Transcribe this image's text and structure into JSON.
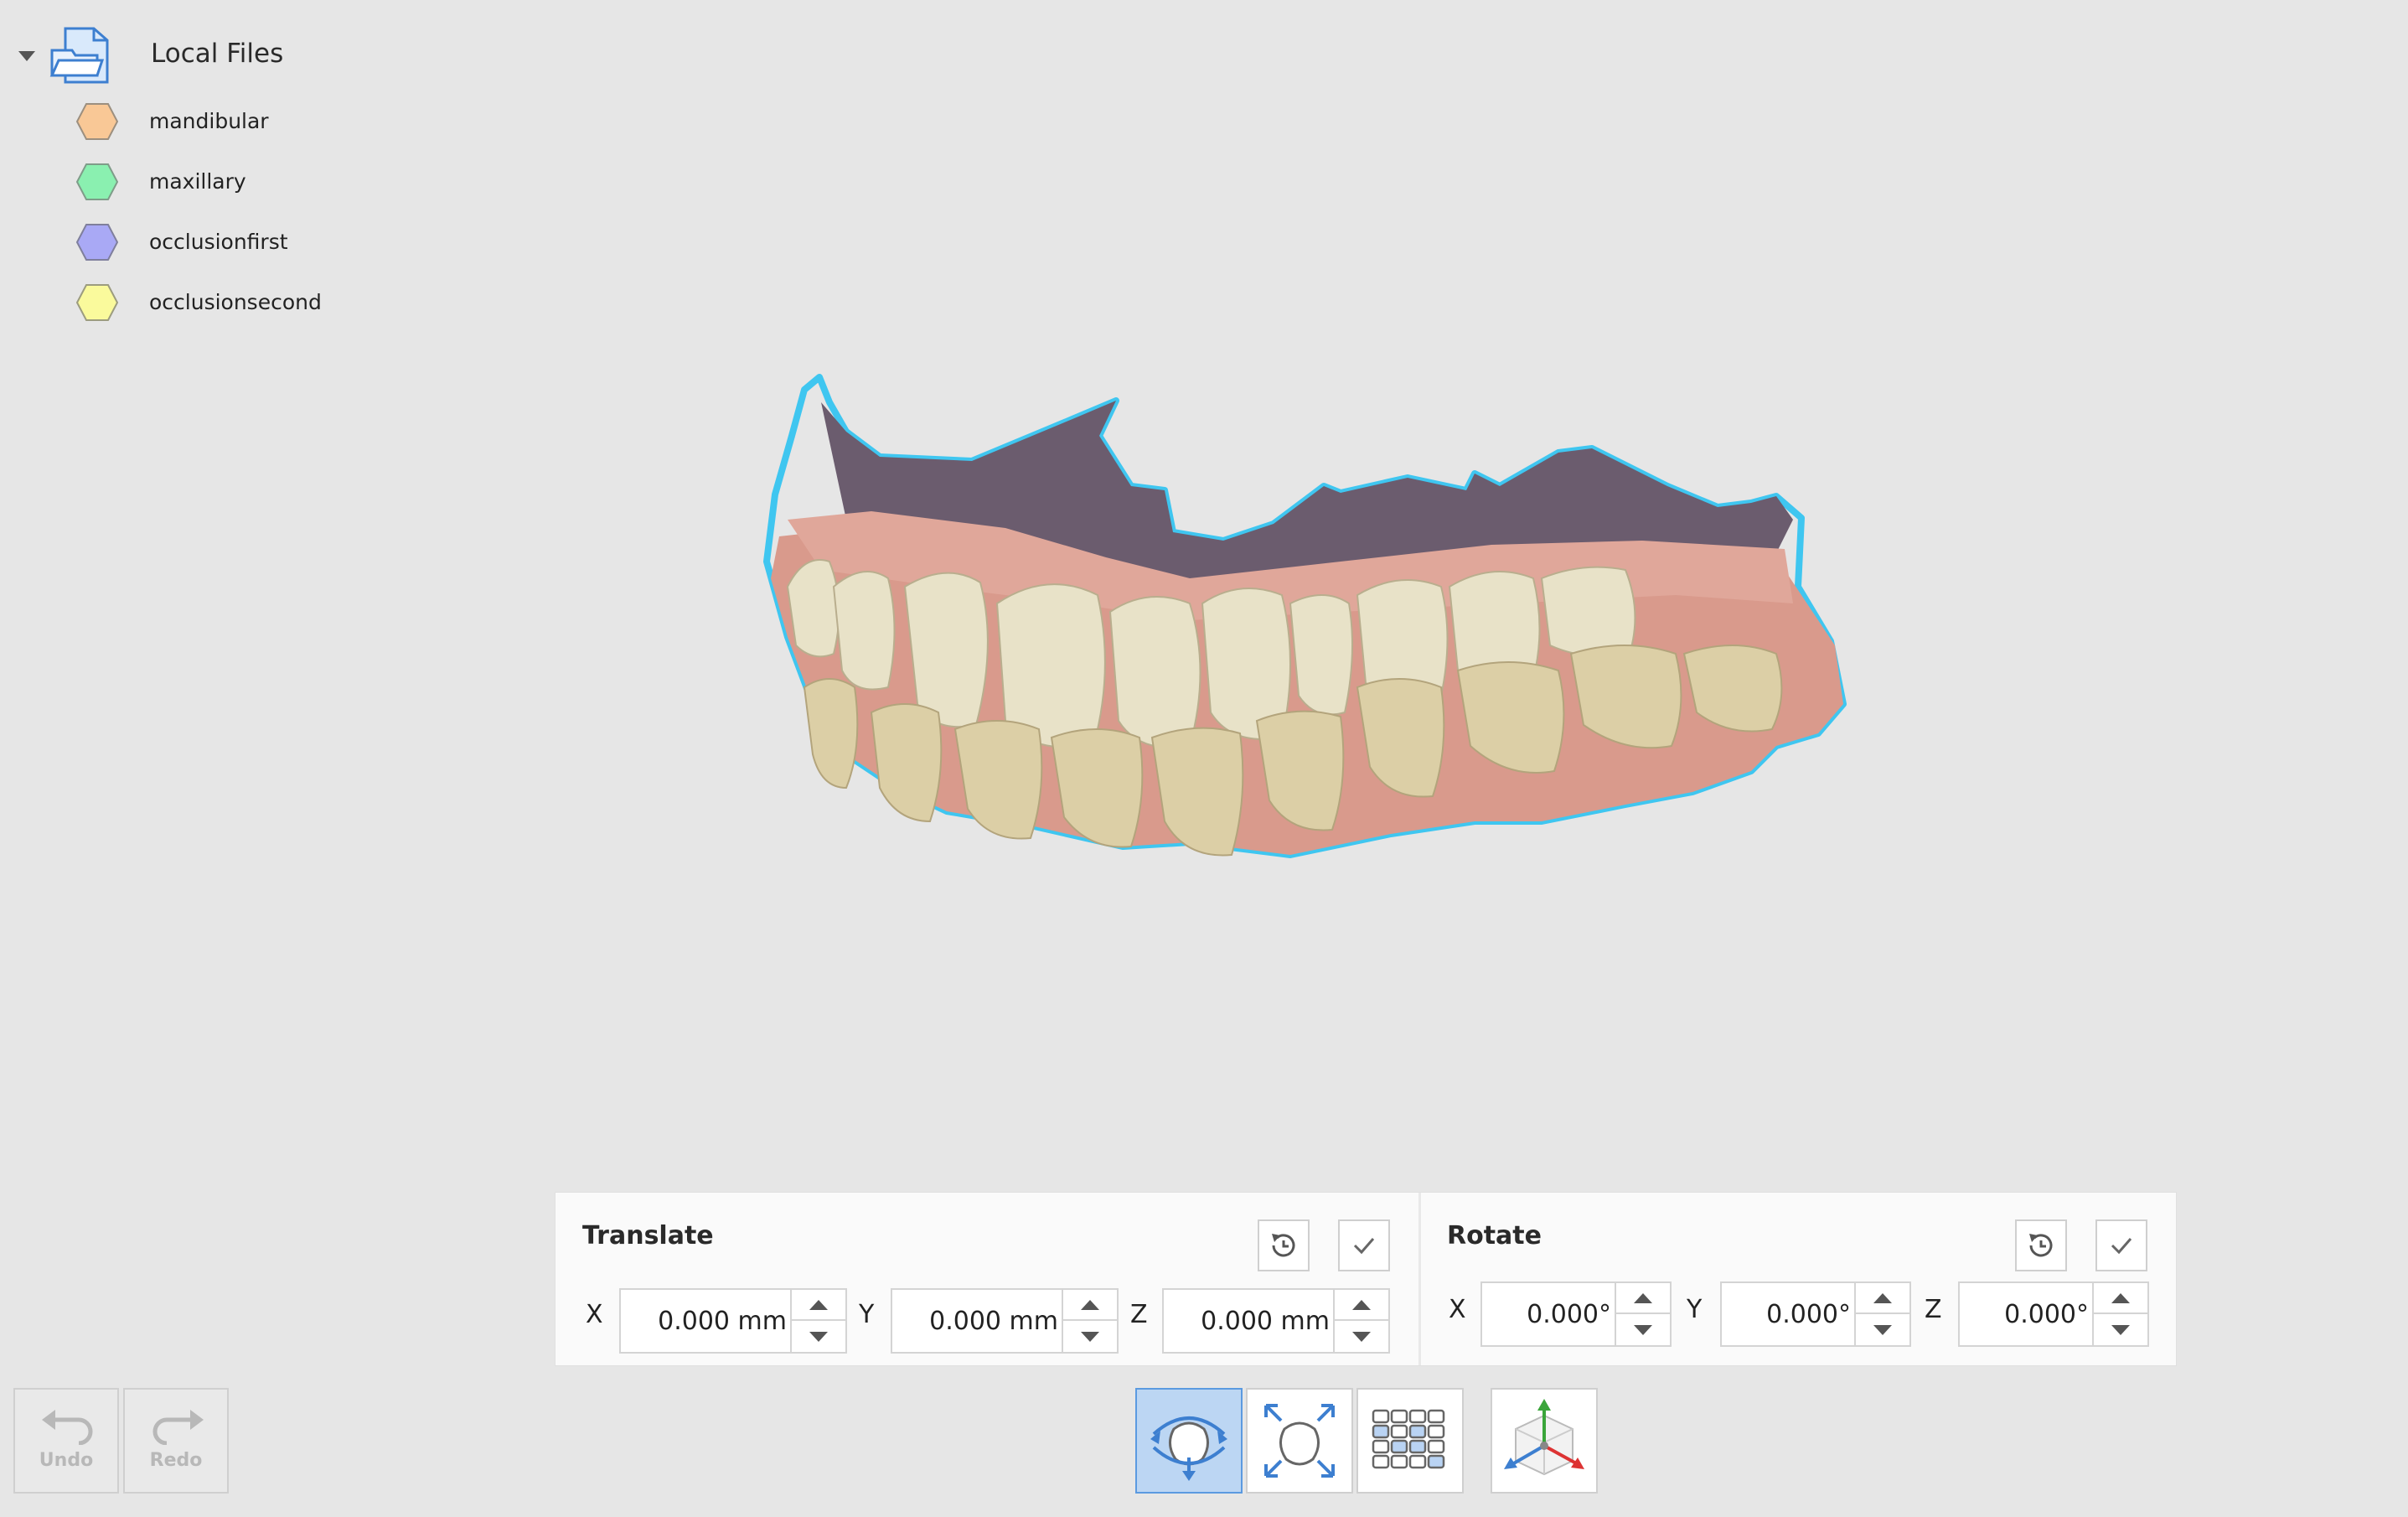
{
  "file_tree": {
    "root_label": "Local Files",
    "items": [
      {
        "label": "mandibular",
        "color": "#f9c896"
      },
      {
        "label": "maxillary",
        "color": "#8af0b0"
      },
      {
        "label": "occlusionfirst",
        "color": "#a9a9f5"
      },
      {
        "label": "occlusionsecond",
        "color": "#fafa9c"
      }
    ]
  },
  "translate": {
    "title": "Translate",
    "fields": [
      {
        "axis": "X",
        "value": "0.000 mm"
      },
      {
        "axis": "Y",
        "value": "0.000 mm"
      },
      {
        "axis": "Z",
        "value": "0.000 mm"
      }
    ]
  },
  "rotate": {
    "title": "Rotate",
    "fields": [
      {
        "axis": "X",
        "value": "0.000°"
      },
      {
        "axis": "Y",
        "value": "0.000°"
      },
      {
        "axis": "Z",
        "value": "0.000°"
      }
    ]
  },
  "history": {
    "undo_label": "Undo",
    "redo_label": "Redo"
  },
  "toolbar": {
    "tools": [
      {
        "icon": "orbit-rotate-icon",
        "active": true
      },
      {
        "icon": "expand-zoom-icon",
        "active": false
      },
      {
        "icon": "grid-layout-icon",
        "active": false
      },
      {
        "icon": "axis-gizmo-icon",
        "active": false
      }
    ]
  },
  "colors": {
    "accent": "#5b9ae0",
    "highlight_outline": "#3fc6f0",
    "background": "#e6e6e6"
  }
}
